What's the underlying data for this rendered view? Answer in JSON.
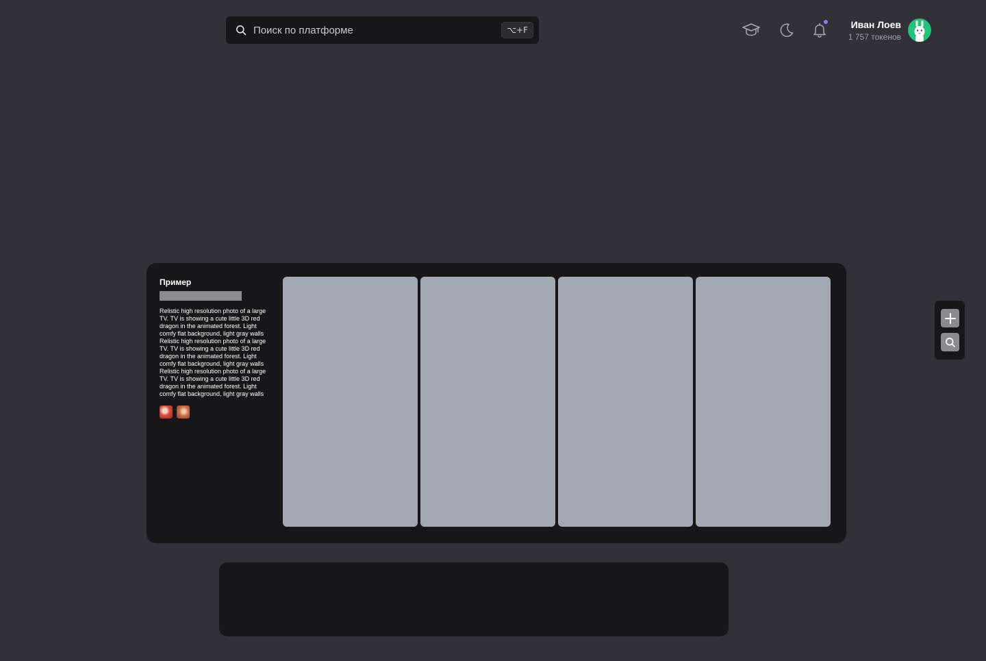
{
  "search": {
    "placeholder": "Поиск по платформе",
    "shortcut": "⌥+F"
  },
  "header": {
    "icons": [
      "graduation-cap-icon",
      "moon-icon",
      "bell-icon"
    ],
    "notification_dot_color": "#8b7cf6"
  },
  "user": {
    "name": "Иван Лоев",
    "tokens": "1 757 токенов"
  },
  "example": {
    "title": "Пример",
    "description": "Relistic high resolution photo of a large TV. TV is showing a cute little 3D red dragon in the animated forest. Light comfy flat background, light gray walls Relistic high resolution photo of a large TV. TV is showing a cute little 3D red dragon in the animated forest. Light comfy flat background, light gray walls Relistic high resolution photo of a large TV. TV is showing a cute little 3D red dragon in the animated forest. Light comfy flat background, light gray walls"
  },
  "tools": [
    "plus-icon",
    "search-icon"
  ],
  "colors": {
    "background": "#323137",
    "surface": "#17171a",
    "panel": "#a3a9b4",
    "accent": "#22c37a"
  }
}
